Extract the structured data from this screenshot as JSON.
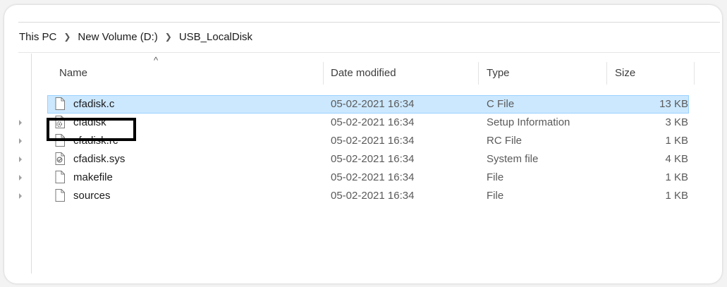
{
  "breadcrumb": [
    {
      "label": "This PC"
    },
    {
      "label": "New Volume (D:)"
    },
    {
      "label": "USB_LocalDisk"
    }
  ],
  "columns": {
    "name": "Name",
    "date": "Date modified",
    "type": "Type",
    "size": "Size"
  },
  "sort_indicator": "^",
  "files": [
    {
      "name": "cfadisk.c",
      "date": "05-02-2021 16:34",
      "type": "C File",
      "size": "13 KB",
      "icon": "document-icon",
      "selected": true
    },
    {
      "name": "cfadisk",
      "date": "05-02-2021 16:34",
      "type": "Setup Information",
      "size": "3 KB",
      "icon": "setup-info-icon",
      "selected": false
    },
    {
      "name": "cfadisk.rc",
      "date": "05-02-2021 16:34",
      "type": "RC File",
      "size": "1 KB",
      "icon": "document-icon",
      "selected": false
    },
    {
      "name": "cfadisk.sys",
      "date": "05-02-2021 16:34",
      "type": "System file",
      "size": "4 KB",
      "icon": "system-file-icon",
      "selected": false
    },
    {
      "name": "makefile",
      "date": "05-02-2021 16:34",
      "type": "File",
      "size": "1 KB",
      "icon": "document-icon",
      "selected": false
    },
    {
      "name": "sources",
      "date": "05-02-2021 16:34",
      "type": "File",
      "size": "1 KB",
      "icon": "document-icon",
      "selected": false
    }
  ],
  "colors": {
    "selection": "#cce8ff",
    "selection_border": "#99d1ff",
    "callout": "#000000"
  }
}
